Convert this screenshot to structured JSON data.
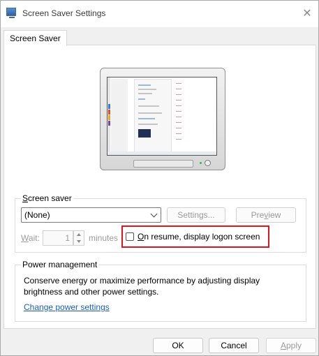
{
  "window": {
    "title": "Screen Saver Settings",
    "close_glyph": "✕"
  },
  "tabs": [
    {
      "label": "Screen Saver"
    }
  ],
  "screen_saver": {
    "group_label_accel": "S",
    "group_label_rest": "creen saver",
    "selected": "(None)",
    "settings_label": "Settings...",
    "preview_label_pre": "Pre",
    "preview_label_accel": "v",
    "preview_label_post": "iew",
    "wait_label_accel": "W",
    "wait_label_rest": "ait:",
    "wait_value": "1",
    "minutes_label": "minutes",
    "resume_label_accel": "O",
    "resume_label_rest": "n resume, display logon screen",
    "resume_checked": false
  },
  "power": {
    "group_label": "Power management",
    "description": "Conserve energy or maximize performance by adjusting display brightness and other power settings.",
    "link_label": "Change power settings"
  },
  "footer": {
    "ok_label": "OK",
    "cancel_label": "Cancel",
    "apply_label_accel": "A",
    "apply_label_rest": "pply"
  },
  "colors": {
    "accent_link": "#1a5fb4",
    "highlight_border": "#e0141e",
    "disabled_text": "#9a9a9a"
  }
}
